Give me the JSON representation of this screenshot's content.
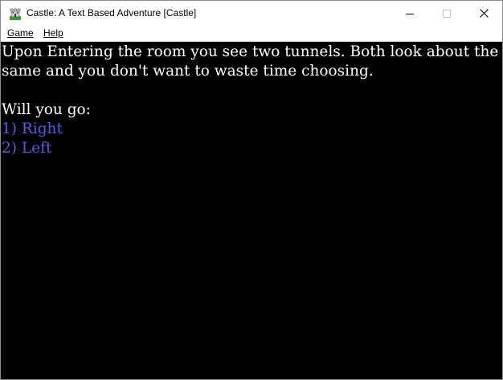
{
  "window": {
    "title": "Castle: A Text Based Adventure [Castle]",
    "minimize_glyph": "—",
    "maximize_glyph": "☐",
    "close_glyph": "✕"
  },
  "menu": {
    "items": [
      {
        "label": "Game"
      },
      {
        "label": "Help"
      }
    ]
  },
  "console": {
    "background": "#000000",
    "text_color": "#ffffff",
    "choice_color": "#5a5ae6",
    "narration_lines": [
      "Upon Entering the room you see two tunnels. Both look about the",
      "same and you don't want to waste time choosing."
    ],
    "prompt": "Will you go:",
    "choices": [
      {
        "label": "1) Right"
      },
      {
        "label": "2) Left"
      }
    ]
  }
}
